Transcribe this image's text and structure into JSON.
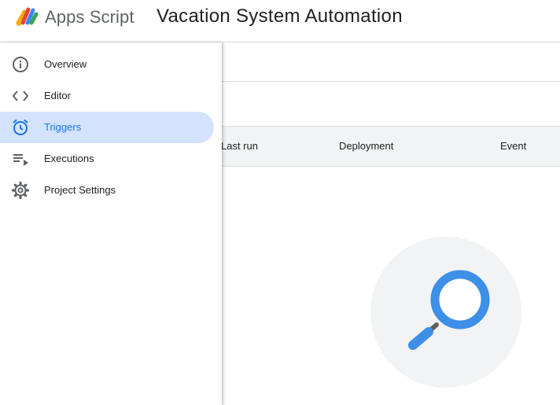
{
  "header": {
    "brand": "Apps Script",
    "project_title": "Vacation System Automation",
    "logo_icon": "apps-script-logo"
  },
  "sidebar": {
    "items": [
      {
        "label": "Overview",
        "icon": "info-icon",
        "active": false
      },
      {
        "label": "Editor",
        "icon": "code-icon",
        "active": false
      },
      {
        "label": "Triggers",
        "icon": "alarm-clock-icon",
        "active": true
      },
      {
        "label": "Executions",
        "icon": "playlist-play-icon",
        "active": false
      },
      {
        "label": "Project Settings",
        "icon": "gear-icon",
        "active": false
      }
    ]
  },
  "table": {
    "columns": [
      "Last run",
      "Deployment",
      "Event"
    ]
  },
  "empty_state": {
    "icon": "magnifier-icon"
  },
  "colors": {
    "accent": "#1a73e8",
    "active_bg": "#d3e3fd",
    "magnifier_blue": "#3d8fe8",
    "illustration_bg": "#f1f3f4"
  }
}
